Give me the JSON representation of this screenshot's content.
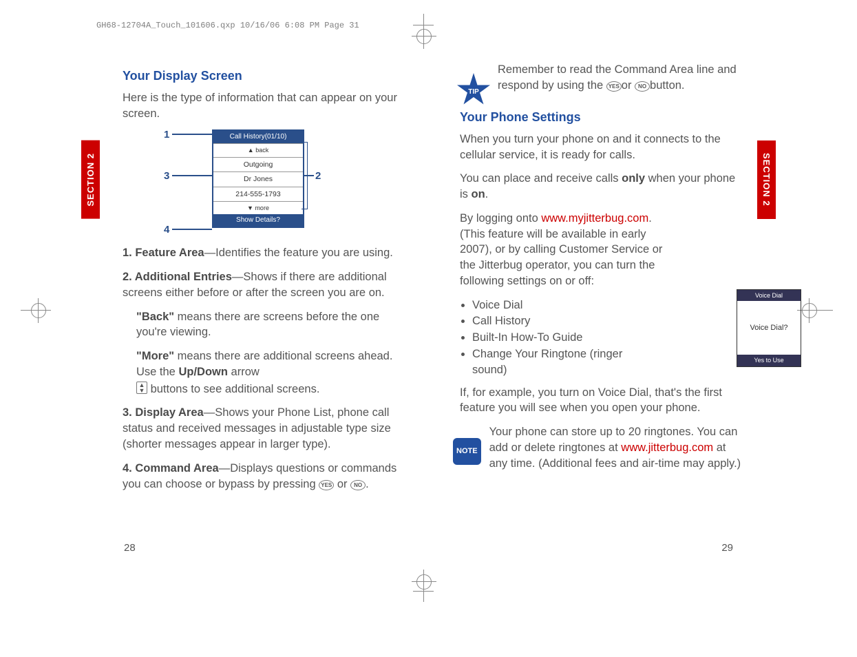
{
  "header": "GH68-12704A_Touch_101606.qxp  10/16/06  6:08 PM  Page 31",
  "section_label": "SECTION 2",
  "left": {
    "h1": "Your Display Screen",
    "intro": "Here is the type of information that can appear on your screen.",
    "screen": {
      "title": "Call History(01/10)",
      "back": "▲ back",
      "row1": "Outgoing",
      "row2": "Dr Jones",
      "row3": "214-555-1793",
      "more": "▼ more",
      "cmd": "Show Details?"
    },
    "item1_label": "1. Feature Area",
    "item1_text": "—Identifies the feature you are using.",
    "item2_label": "2. Additional Entries",
    "item2_text": "—Shows if there are additional screens either before or after the screen you are on.",
    "back_label": "\"Back\"",
    "back_text": " means there are screens before the one you're viewing.",
    "more_label": "\"More\"",
    "more_text": " means there are additional screens ahead. Use the ",
    "updown": "Up/Down",
    "more_text2": " arrow",
    "more_text3": " buttons to see additional screens.",
    "item3_label": "3. Display Area",
    "item3_text": "—Shows your Phone List, phone call status and received messages in adjustable type size (shorter messages appear in larger type).",
    "item4_label": "4. Command Area",
    "item4_text": "—Displays questions or commands you can choose or bypass by pressing ",
    "or": "or",
    "page_num": "28"
  },
  "right": {
    "tip_label": "TIP",
    "tip_text1": "Remember to read the Command Area line and respond by using the ",
    "tip_or": "or",
    "tip_text2": "button.",
    "h2": "Your Phone Settings",
    "p1": "When you turn your phone on and it connects to the cellular service, it is ready for calls.",
    "p2a": "You can place and receive calls ",
    "p2b": "only",
    "p2c": " when your phone is ",
    "p2d": "on",
    "p2e": ".",
    "p3a": "By logging onto ",
    "link1": "www.myjitterbug.com",
    "p3b": ". (This feature will be available in early 2007), or by calling Customer Service or the Jitterbug operator, you can turn the following settings on or off:",
    "settings": [
      "Voice Dial",
      "Call History",
      "Built-In How-To Guide",
      "Change Your Ringtone (ringer sound)"
    ],
    "mini": {
      "title": "Voice Dial",
      "body": "Voice Dial?",
      "cmd": "Yes to Use"
    },
    "p4": "If, for example, you turn on Voice Dial, that's the first feature you will see when you open your phone.",
    "note_label": "NOTE",
    "note_a": "Your phone can store up to 20 ringtones. You can add or delete ringtones at ",
    "link2": "www.jitterbug.com",
    "note_b": " at any time. (Additional fees and air-time may apply.)",
    "page_num": "29"
  },
  "yes": "YES",
  "no": "NO"
}
